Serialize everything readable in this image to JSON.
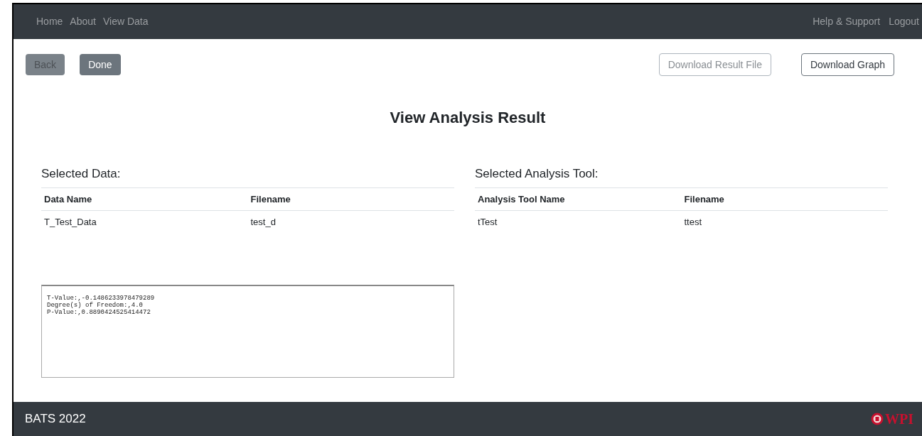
{
  "navbar": {
    "left_links": [
      "Home",
      "About",
      "View Data"
    ],
    "right_links": [
      "Help & Support",
      "Logout"
    ]
  },
  "actions": {
    "left": [
      {
        "label": "Back",
        "disabled": true
      },
      {
        "label": "Done",
        "disabled": false
      }
    ],
    "right": [
      {
        "label": "Download Result File",
        "disabled": true
      },
      {
        "label": "Download Graph",
        "disabled": false
      }
    ]
  },
  "title": "View Analysis Result",
  "panels": [
    {
      "heading": "Selected Data:",
      "columns": [
        "Data Name",
        "Filename"
      ],
      "rows": [
        [
          "T_Test_Data",
          "test_d"
        ]
      ]
    },
    {
      "heading": "Selected Analysis Tool:",
      "columns": [
        "Analysis Tool Name",
        "Filename"
      ],
      "rows": [
        [
          "tTest",
          "ttest"
        ]
      ]
    }
  ],
  "result_text": [
    "T-Value:,-0.1486233978479289",
    "Degree(s) of Freedom:,4.0",
    "P-Value:,0.8890424525414472"
  ],
  "footer": {
    "brand": "BATS 2022",
    "logo_text": "WPI"
  }
}
